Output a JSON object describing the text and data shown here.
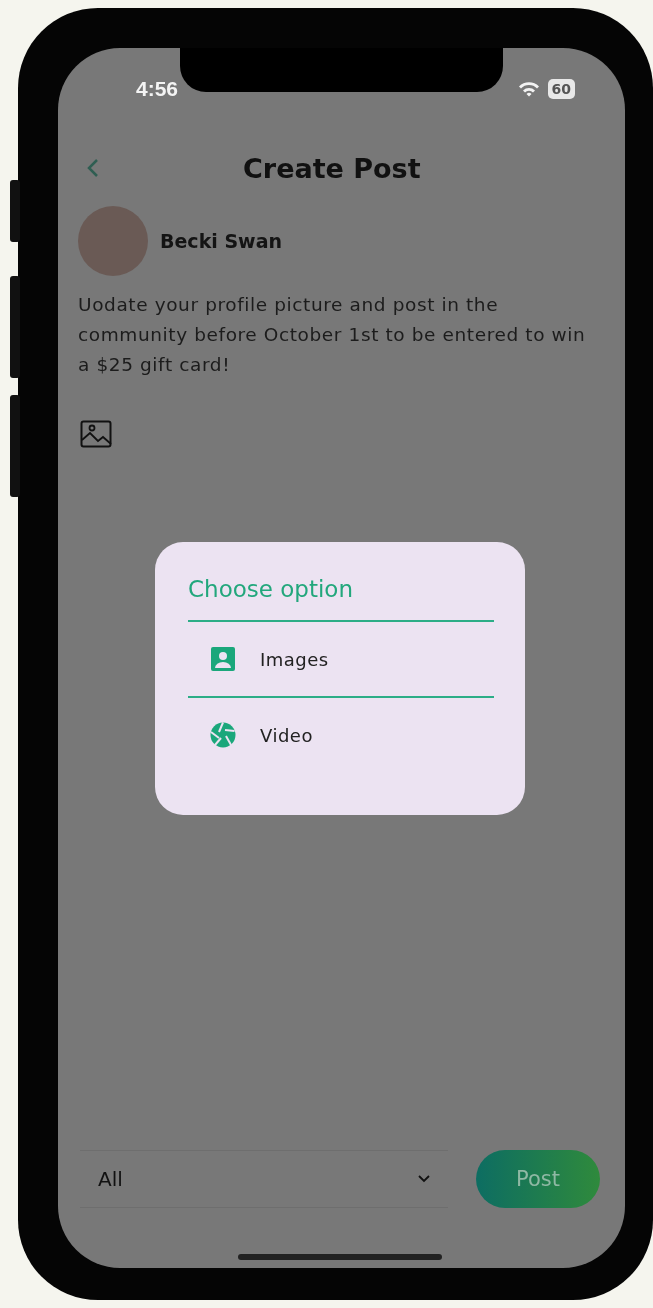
{
  "status_bar": {
    "time": "4:56",
    "battery": "60"
  },
  "header": {
    "title": "Create Post"
  },
  "author": {
    "name": "Becki Swan"
  },
  "post_text": "Uodate your profile picture and post in the community before October 1st to be entered to win a $25 gift card!",
  "dialog": {
    "title": "Choose option",
    "options": [
      {
        "kind": "images",
        "label": "Images"
      },
      {
        "kind": "video",
        "label": "Video"
      }
    ]
  },
  "audience": {
    "value": "All"
  },
  "post_button": {
    "label": "Post"
  }
}
